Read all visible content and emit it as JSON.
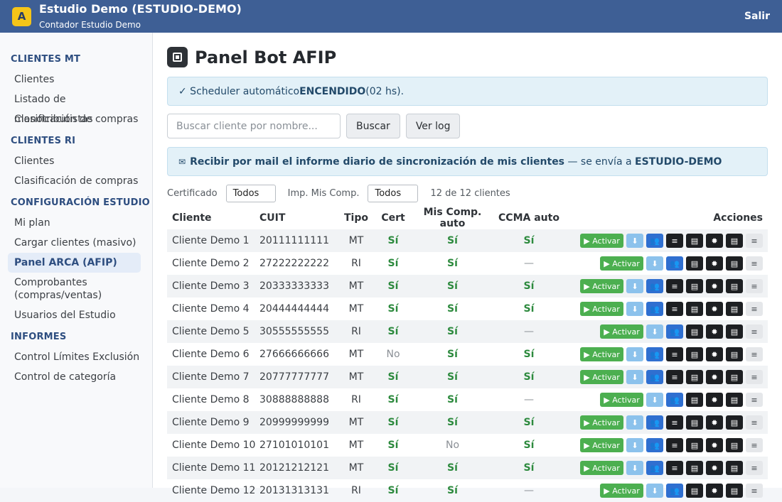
{
  "header": {
    "logo_letter": "A",
    "title": "Estudio Demo (ESTUDIO-DEMO)",
    "subtitle": "Contador Estudio Demo",
    "logout": "Salir"
  },
  "sidebar": {
    "sections": [
      {
        "title": "CLIENTES MT",
        "items": [
          {
            "label": "Clientes",
            "active": false
          },
          {
            "label": "Listado de monotributistas",
            "active": false
          },
          {
            "label": "Clasificación de compras",
            "active": false
          }
        ]
      },
      {
        "title": "CLIENTES RI",
        "items": [
          {
            "label": "Clientes",
            "active": false
          },
          {
            "label": "Clasificación de compras",
            "active": false
          }
        ]
      },
      {
        "title": "CONFIGURACIÓN ESTUDIO",
        "items": [
          {
            "label": "Mi plan",
            "active": false
          },
          {
            "label": "Cargar clientes (masivo)",
            "active": false
          },
          {
            "label": "Panel ARCA (AFIP)",
            "active": true
          },
          {
            "label": "Comprobantes\n(compras/ventas)",
            "active": false
          },
          {
            "label": "Usuarios del Estudio",
            "active": false
          }
        ]
      },
      {
        "title": "INFORMES",
        "items": [
          {
            "label": "Control Límites Exclusión",
            "active": false
          },
          {
            "label": "Control de categoría",
            "active": false
          }
        ]
      }
    ]
  },
  "page": {
    "title": "Panel Bot AFIP",
    "scheduler": {
      "prefix": "✓ Scheduler automático ",
      "status": "ENCENDIDO",
      "suffix": " (02 hs)."
    },
    "search": {
      "placeholder": "Buscar cliente por nombre...",
      "button": "Buscar",
      "log_button": "Ver log"
    },
    "mail": {
      "icon": "✉",
      "strong": "Recibir por mail el informe diario de sincronización de mis clientes",
      "middle": " — se envía a ",
      "target": "ESTUDIO-DEMO"
    },
    "filters": {
      "cert_label": "Certificado",
      "cert_value": "Todos",
      "imp_label": "Imp. Mis Comp.",
      "imp_value": "Todos",
      "count": "12 de 12 clientes"
    }
  },
  "table": {
    "columns": [
      "Cliente",
      "CUIT",
      "Tipo",
      "Cert",
      "Mis Comp. auto",
      "CCMA auto",
      "Acciones"
    ],
    "action_labels": {
      "activar": "▶ Activar",
      "download": "⬇",
      "people": "👥",
      "menu": "≡"
    },
    "rows": [
      {
        "name": "Cliente Demo 1",
        "cuit": "20111111111",
        "tipo": "MT",
        "cert": "Sí",
        "mis": "Sí",
        "ccma": "Sí"
      },
      {
        "name": "Cliente Demo 2",
        "cuit": "27222222222",
        "tipo": "RI",
        "cert": "Sí",
        "mis": "Sí",
        "ccma": "—"
      },
      {
        "name": "Cliente Demo 3",
        "cuit": "20333333333",
        "tipo": "MT",
        "cert": "Sí",
        "mis": "Sí",
        "ccma": "Sí"
      },
      {
        "name": "Cliente Demo 4",
        "cuit": "20444444444",
        "tipo": "MT",
        "cert": "Sí",
        "mis": "Sí",
        "ccma": "Sí"
      },
      {
        "name": "Cliente Demo 5",
        "cuit": "30555555555",
        "tipo": "RI",
        "cert": "Sí",
        "mis": "Sí",
        "ccma": "—"
      },
      {
        "name": "Cliente Demo 6",
        "cuit": "27666666666",
        "tipo": "MT",
        "cert": "No",
        "mis": "Sí",
        "ccma": "Sí"
      },
      {
        "name": "Cliente Demo 7",
        "cuit": "20777777777",
        "tipo": "MT",
        "cert": "Sí",
        "mis": "Sí",
        "ccma": "Sí"
      },
      {
        "name": "Cliente Demo 8",
        "cuit": "30888888888",
        "tipo": "RI",
        "cert": "Sí",
        "mis": "Sí",
        "ccma": "—"
      },
      {
        "name": "Cliente Demo 9",
        "cuit": "20999999999",
        "tipo": "MT",
        "cert": "Sí",
        "mis": "Sí",
        "ccma": "Sí"
      },
      {
        "name": "Cliente Demo 10",
        "cuit": "27101010101",
        "tipo": "MT",
        "cert": "Sí",
        "mis": "No",
        "ccma": "Sí"
      },
      {
        "name": "Cliente Demo 11",
        "cuit": "20121212121",
        "tipo": "MT",
        "cert": "Sí",
        "mis": "Sí",
        "ccma": "Sí"
      },
      {
        "name": "Cliente Demo 12",
        "cuit": "20131313131",
        "tipo": "RI",
        "cert": "Sí",
        "mis": "Sí",
        "ccma": "—"
      }
    ]
  },
  "colors": {
    "header": "#3e5f95",
    "accent_green": "#4caf50",
    "yes_green": "#2d8a3e",
    "blue": "#2f6fd0"
  }
}
